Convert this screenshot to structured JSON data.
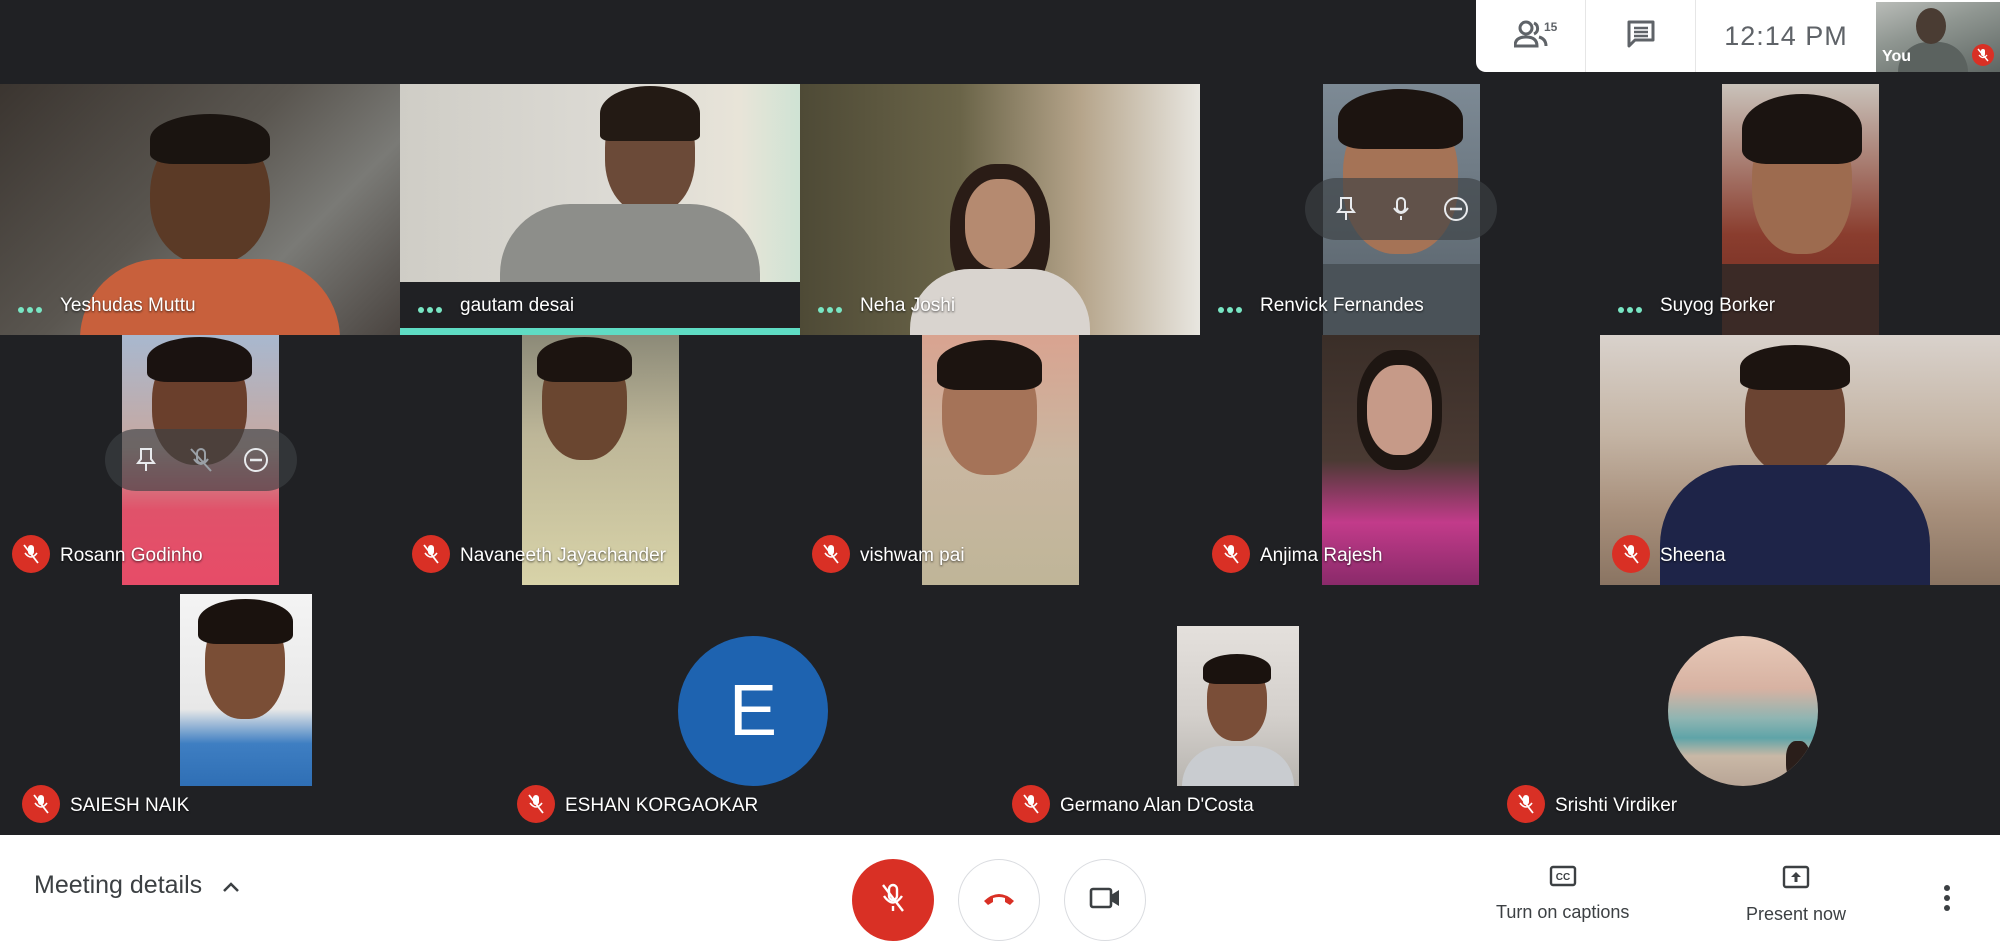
{
  "topbar": {
    "people_count": "15",
    "time": "12:14 PM",
    "self_label": "You"
  },
  "colors": {
    "speaking_accent": "#5fdcc4",
    "muted_red": "#d93025",
    "avatar_blue": "#1e63b0",
    "tile_bg": "#202124"
  },
  "participants": [
    {
      "name": "Yeshudas Muttu",
      "status": "audio-active",
      "video": "on"
    },
    {
      "name": "gautam desai",
      "status": "speaking",
      "video": "on"
    },
    {
      "name": "Neha Joshi",
      "status": "audio-active",
      "video": "on"
    },
    {
      "name": "Renvick Fernandes",
      "status": "audio-active",
      "video": "on",
      "hover_controls": [
        "pin",
        "mic",
        "remove"
      ]
    },
    {
      "name": "Suyog Borker",
      "status": "audio-active",
      "video": "on"
    },
    {
      "name": "Rosann Godinho",
      "status": "muted",
      "video": "on",
      "hover_controls": [
        "pin",
        "mic-off",
        "remove"
      ]
    },
    {
      "name": "Navaneeth Jayachander",
      "status": "muted",
      "video": "on"
    },
    {
      "name": "vishwam pai",
      "status": "muted",
      "video": "on"
    },
    {
      "name": "Anjima Rajesh",
      "status": "muted",
      "video": "on"
    },
    {
      "name": "Sheena",
      "status": "muted",
      "video": "on"
    },
    {
      "name": "SAIESH NAIK",
      "status": "muted",
      "video": "on"
    },
    {
      "name": "ESHAN KORGAOKAR",
      "status": "muted",
      "video": "off",
      "avatar_letter": "E"
    },
    {
      "name": "Germano Alan D'Costa",
      "status": "muted",
      "video": "on"
    },
    {
      "name": "Srishti Virdiker",
      "status": "muted",
      "video": "off",
      "avatar": "photo"
    }
  ],
  "bottombar": {
    "meeting_details": "Meeting details",
    "captions": "Turn on captions",
    "present": "Present now"
  }
}
